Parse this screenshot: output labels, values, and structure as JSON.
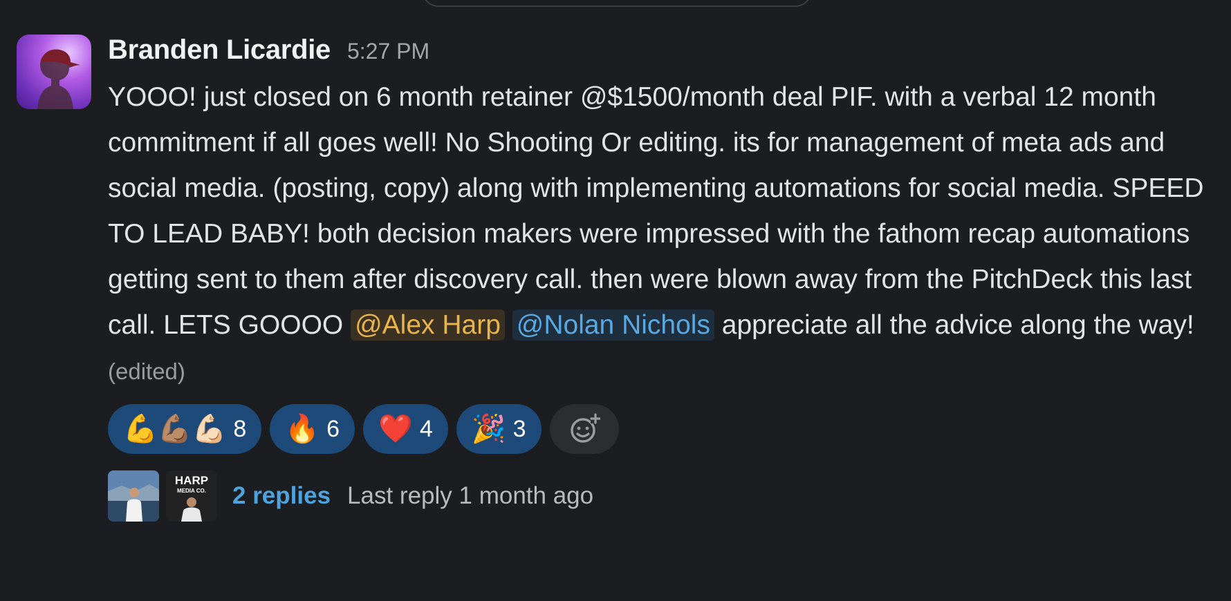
{
  "message": {
    "author": "Branden Licardie",
    "time": "5:27 PM",
    "text_before": "YOOO! just closed on 6 month retainer @$1500/month deal PIF. with a verbal 12 month commitment if all goes well! No Shooting Or editing. its for management of meta ads and social media. (posting, copy) along with implementing automations for social media. SPEED TO LEAD BABY! both decision makers were impressed with the fathom recap automations getting sent to them after discovery call. then were blown away from the PitchDeck this last call. LETS GOOOO ",
    "mention_1": "@Alex Harp",
    "mention_2": "@Nolan Nichols",
    "text_after": " appreciate all the advice along the way!",
    "edited": "(edited)"
  },
  "reactions": [
    {
      "emoji": "💪💪🏽💪🏻",
      "icon": "flexed-biceps-icon",
      "count": "8"
    },
    {
      "emoji": "🔥",
      "icon": "fire-icon",
      "count": "6"
    },
    {
      "emoji": "❤️",
      "icon": "heart-icon",
      "count": "4"
    },
    {
      "emoji": "🎉",
      "icon": "party-popper-icon",
      "count": "3"
    }
  ],
  "add_reaction_icon": "add-reaction-icon",
  "thread": {
    "replies": "2 replies",
    "last_reply": "Last reply 1 month ago",
    "avatar_2_logo_text_1": "HARP",
    "avatar_2_logo_text_2": "MEDIA CO."
  },
  "colors": {
    "background": "#1b1d21",
    "reaction_bg": "#1d4a78",
    "link": "#4fa3dc",
    "mention_alex": "#e8b44c",
    "mention_nolan": "#5aa8e0"
  }
}
